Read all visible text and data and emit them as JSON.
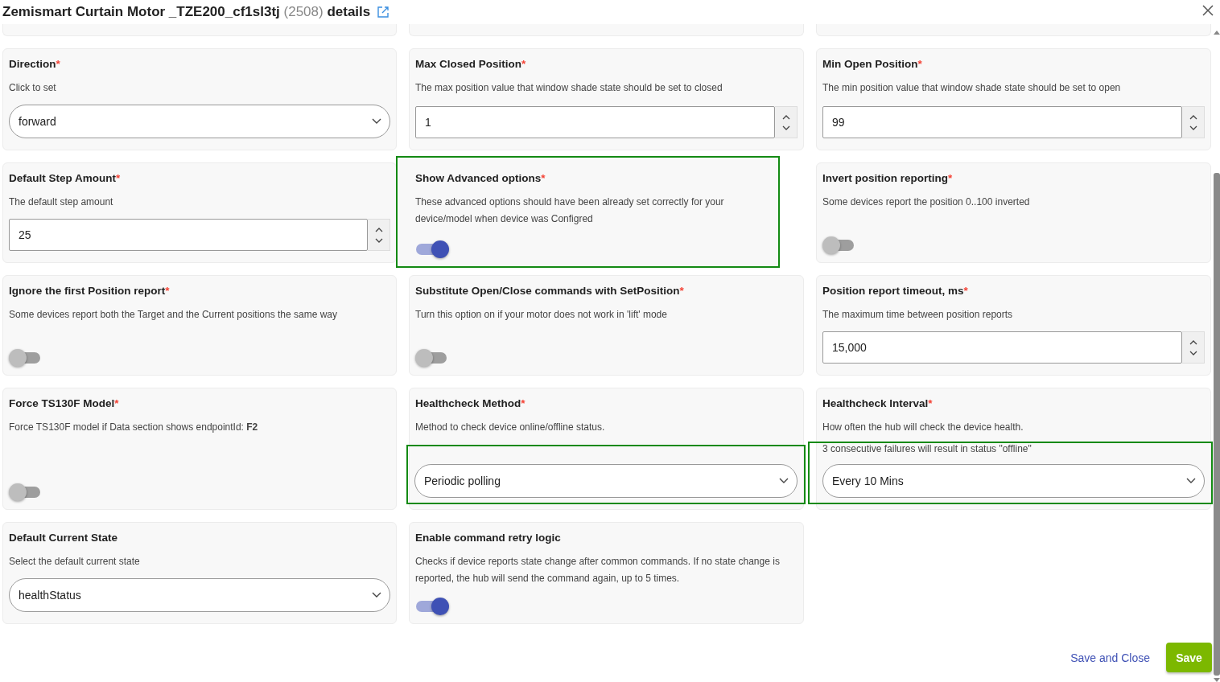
{
  "dialog": {
    "title": "Zemismart Curtain Motor _TZE200_cf1sl3tj",
    "count": "(2508)",
    "suffix": "details"
  },
  "cards": [
    {
      "title": "Direction",
      "mark": "*",
      "description": "Click to set",
      "control": {
        "kind": "select",
        "value": "forward"
      }
    },
    {
      "title": "Max Closed Position",
      "mark": "*",
      "description": "The max position value that window shade state should be set to closed",
      "control": {
        "kind": "number",
        "value": "1"
      }
    },
    {
      "title": "Min Open Position",
      "mark": "*",
      "description": "The min position value that window shade state should be set to open",
      "control": {
        "kind": "number",
        "value": "99"
      }
    },
    {
      "title": "Default Step Amount",
      "mark": "*",
      "description": "The default step amount",
      "control": {
        "kind": "number",
        "value": "25"
      }
    },
    {
      "title": "Show Advanced options",
      "mark": "*",
      "description": "These advanced options should have been already set correctly for your device/model when device was Configred",
      "highlighted": true,
      "control": {
        "kind": "toggle",
        "on": true
      }
    },
    {
      "title": "Invert position reporting",
      "mark": "*",
      "description": "Some devices report the position 0..100 inverted",
      "control": {
        "kind": "toggle",
        "on": false
      }
    },
    {
      "title": "Ignore the first Position report",
      "mark": "*",
      "description": "Some devices report both the Target and the Current positions the same way",
      "control": {
        "kind": "toggle",
        "on": false
      }
    },
    {
      "title": "Substitute Open/Close commands with SetPosition",
      "mark": "*",
      "description": "Turn this option on if your motor does not work in 'lift' mode",
      "control": {
        "kind": "toggle",
        "on": false
      }
    },
    {
      "title": "Position report timeout, ms",
      "mark": "*",
      "description": "The maximum time between position reports",
      "control": {
        "kind": "number",
        "value": "15,000"
      }
    },
    {
      "title": "Force TS130F Model",
      "mark": "*",
      "description": "Force TS130F model if Data section shows endpointId: **F2**",
      "control": {
        "kind": "toggle",
        "on": false
      }
    },
    {
      "title": "Healthcheck Method",
      "mark": "*",
      "description": "Method to check device online/offline status.",
      "control": {
        "kind": "select",
        "value": "Periodic polling",
        "highlighted": true
      }
    },
    {
      "title": "Healthcheck Interval",
      "mark": "*",
      "description": "How often the hub will check the device health.",
      "note": "3 consecutive failures will result in status \"offline\"",
      "control": {
        "kind": "select",
        "value": "Every 10 Mins",
        "highlighted": true
      }
    },
    {
      "title": "Default Current State",
      "description": "Select the default current state",
      "control": {
        "kind": "select",
        "value": "healthStatus"
      }
    },
    {
      "title": "Enable command retry logic",
      "description": "Checks if device reports state change after common commands. If no state change is reported, the hub will send the command again, up to 5 times.",
      "control": {
        "kind": "toggle",
        "on": true
      }
    }
  ],
  "footer": {
    "link": "Save and Close",
    "button": "Save"
  }
}
